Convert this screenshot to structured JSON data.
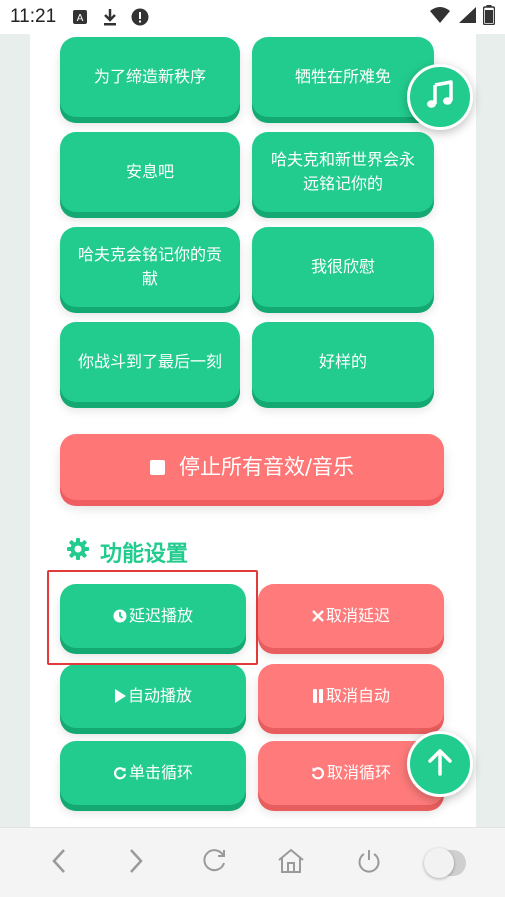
{
  "status_bar": {
    "time": "11:21"
  },
  "sound_buttons": [
    {
      "label": "为了缔造新秩序"
    },
    {
      "label": "牺牲在所难免"
    },
    {
      "label": "安息吧"
    },
    {
      "label": "哈夫克和新世界会永远铭记你的"
    },
    {
      "label": "哈夫克会铭记你的贡献"
    },
    {
      "label": "我很欣慰"
    },
    {
      "label": "你战斗到了最后一刻"
    },
    {
      "label": "好样的"
    }
  ],
  "stop_all_label": "停止所有音效/音乐",
  "settings": {
    "title": "功能设置",
    "delay_play": "延迟播放",
    "cancel_delay": "取消延迟",
    "auto_play": "自动播放",
    "cancel_auto": "取消自动",
    "single_loop": "单击循环",
    "cancel_loop": "取消循环"
  },
  "colors": {
    "primary": "#22cc8e",
    "danger": "#ff7b7b",
    "highlight": "#e23a3a"
  },
  "icons": {
    "music_fab": "music-note-icon",
    "scroll_top_fab": "arrow-up-icon"
  }
}
